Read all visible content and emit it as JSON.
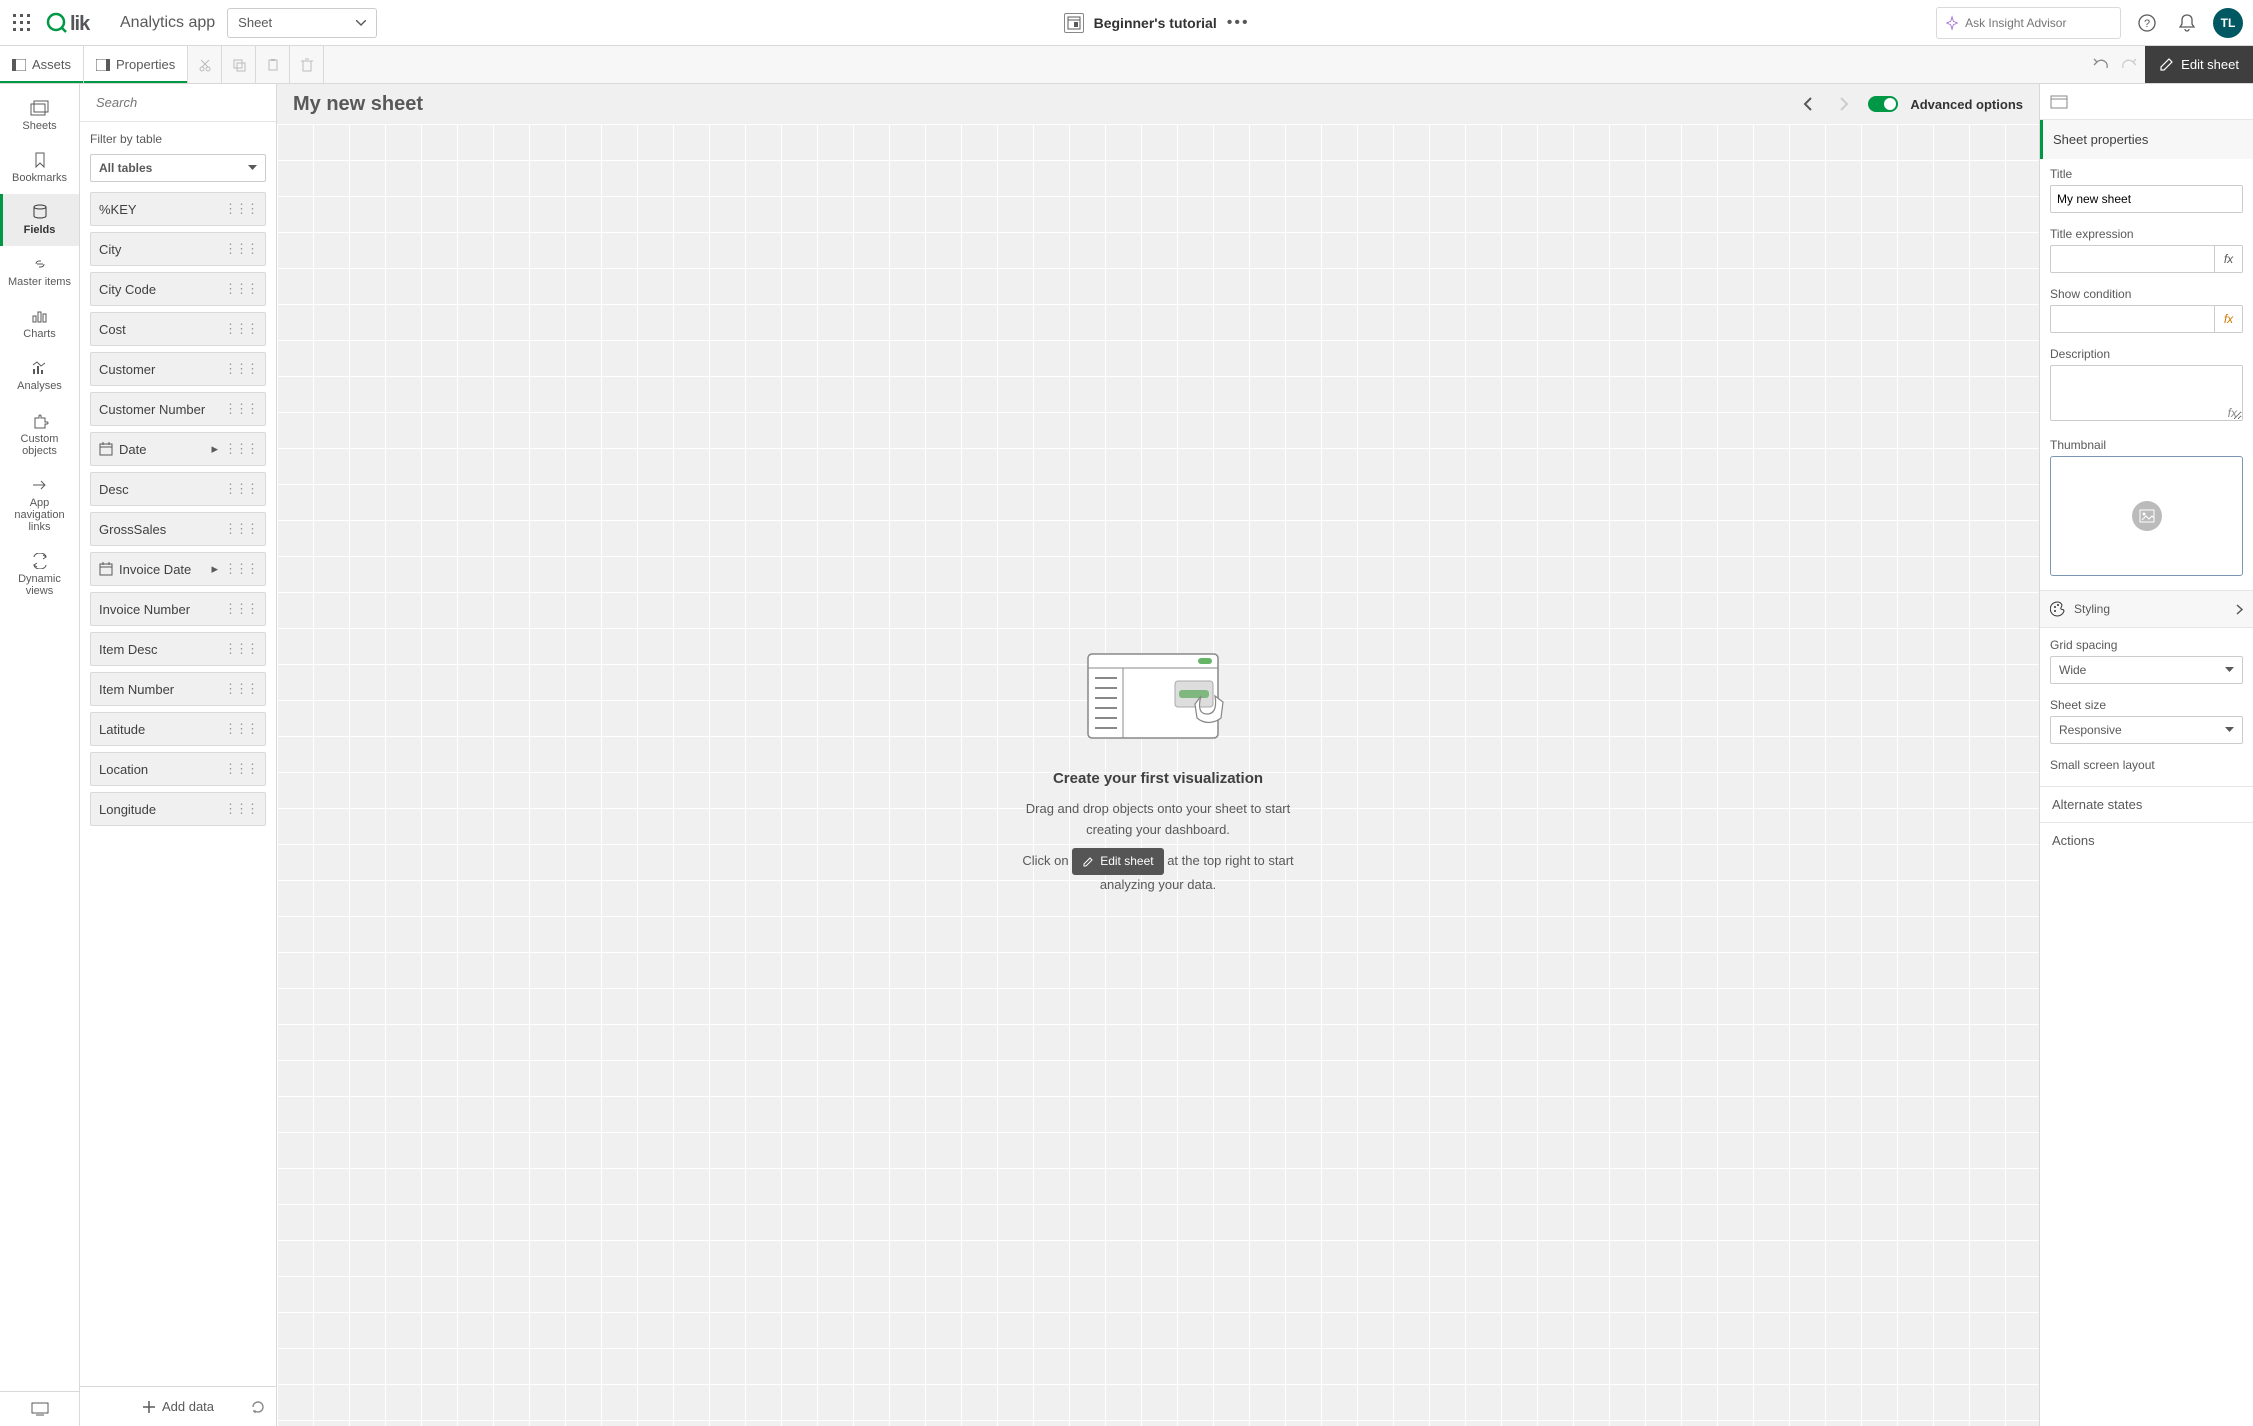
{
  "topbar": {
    "appName": "Analytics app",
    "sheetDropdown": "Sheet",
    "tutorial": "Beginner's tutorial",
    "insightPlaceholder": "Ask Insight Advisor",
    "avatar": "TL"
  },
  "toolbar": {
    "assets": "Assets",
    "properties": "Properties",
    "editSheet": "Edit sheet"
  },
  "rail": {
    "items": [
      "Sheets",
      "Bookmarks",
      "Fields",
      "Master items",
      "Charts",
      "Analyses",
      "Custom objects",
      "App navigation links",
      "Dynamic views"
    ]
  },
  "assets": {
    "searchPlaceholder": "Search",
    "filterLabel": "Filter by table",
    "filterValue": "All tables",
    "fields": [
      {
        "label": "%KEY",
        "type": "field"
      },
      {
        "label": "City",
        "type": "field"
      },
      {
        "label": "City Code",
        "type": "field"
      },
      {
        "label": "Cost",
        "type": "field"
      },
      {
        "label": "Customer",
        "type": "field"
      },
      {
        "label": "Customer Number",
        "type": "field"
      },
      {
        "label": "Date",
        "type": "date"
      },
      {
        "label": "Desc",
        "type": "field"
      },
      {
        "label": "GrossSales",
        "type": "field"
      },
      {
        "label": "Invoice Date",
        "type": "date"
      },
      {
        "label": "Invoice Number",
        "type": "field"
      },
      {
        "label": "Item Desc",
        "type": "field"
      },
      {
        "label": "Item Number",
        "type": "field"
      },
      {
        "label": "Latitude",
        "type": "field"
      },
      {
        "label": "Location",
        "type": "field"
      },
      {
        "label": "Longitude",
        "type": "field"
      }
    ],
    "addData": "Add data"
  },
  "canvas": {
    "sheetTitle": "My new sheet",
    "advOptions": "Advanced options",
    "emptyTitle": "Create your first visualization",
    "emptyLine1": "Drag and drop objects onto your sheet to start creating your dashboard.",
    "emptyLine2a": "Click on",
    "emptyInlineBtn": "Edit sheet",
    "emptyLine2b": "at the top right to start analyzing your data."
  },
  "props": {
    "header": "Sheet properties",
    "titleLabel": "Title",
    "titleValue": "My new sheet",
    "titleExprLabel": "Title expression",
    "showCondLabel": "Show condition",
    "descLabel": "Description",
    "thumbnailLabel": "Thumbnail",
    "stylingLabel": "Styling",
    "gridSpacingLabel": "Grid spacing",
    "gridSpacingValue": "Wide",
    "sheetSizeLabel": "Sheet size",
    "sheetSizeValue": "Responsive",
    "smallScreenLabel": "Small screen layout",
    "altStates": "Alternate states",
    "actions": "Actions"
  }
}
